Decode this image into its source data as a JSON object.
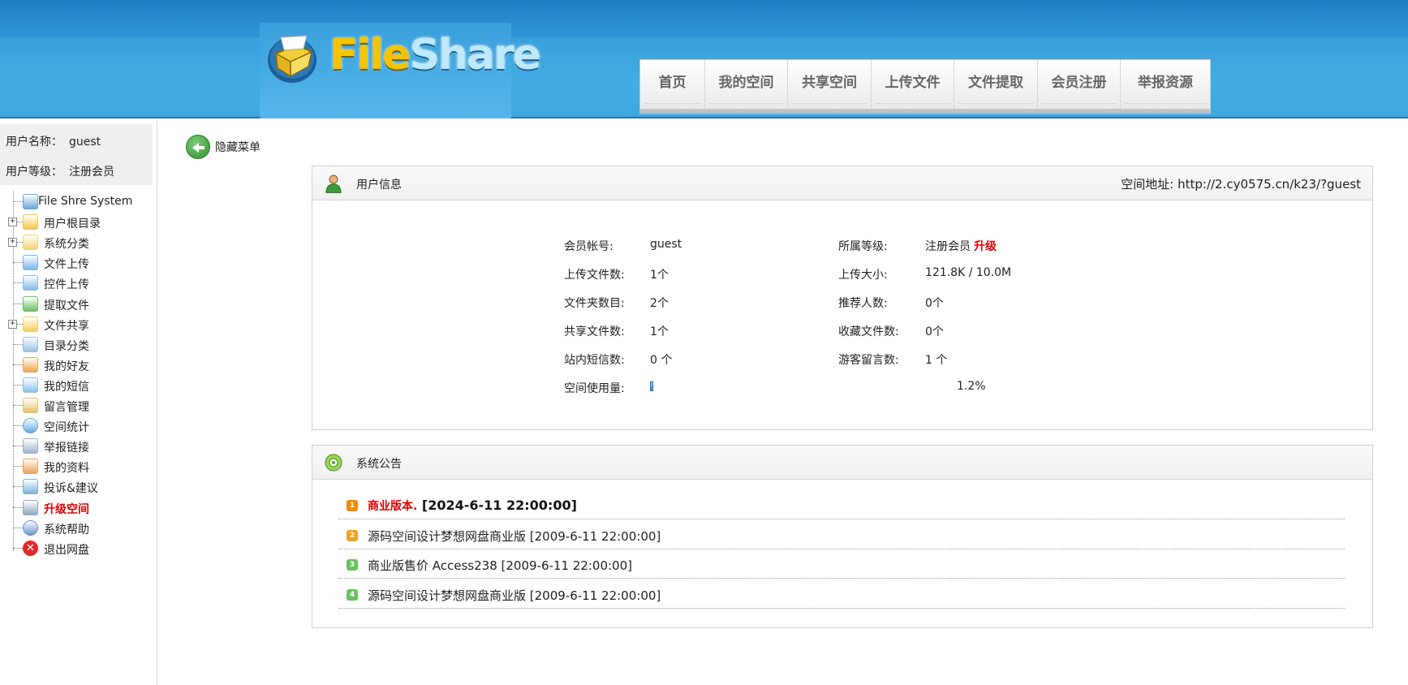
{
  "header": {
    "logo_part1": "File",
    "logo_part2": "Share",
    "nav": [
      "首页",
      "我的空间",
      "共享空间",
      "上传文件",
      "文件提取",
      "会员注册",
      "举报资源"
    ]
  },
  "sidebar": {
    "username_label": "用户名称：",
    "username_value": "guest",
    "level_label": "用户等级：",
    "level_value": "注册会员",
    "items": [
      {
        "label": "File Shre System",
        "icon": "system-icon",
        "expandable": false,
        "highlight": false
      },
      {
        "label": "用户根目录",
        "icon": "folder-icon",
        "expandable": true,
        "highlight": false
      },
      {
        "label": "系统分类",
        "icon": "folders-icon",
        "expandable": true,
        "highlight": false
      },
      {
        "label": "文件上传",
        "icon": "file-upload-icon",
        "expandable": false,
        "highlight": false
      },
      {
        "label": "控件上传",
        "icon": "control-upload-icon",
        "expandable": false,
        "highlight": false
      },
      {
        "label": "提取文件",
        "icon": "extract-icon",
        "expandable": false,
        "highlight": false
      },
      {
        "label": "文件共享",
        "icon": "shared-folder-icon",
        "expandable": true,
        "highlight": false
      },
      {
        "label": "目录分类",
        "icon": "catalog-icon",
        "expandable": false,
        "highlight": false
      },
      {
        "label": "我的好友",
        "icon": "friends-icon",
        "expandable": false,
        "highlight": false
      },
      {
        "label": "我的短信",
        "icon": "message-icon",
        "expandable": false,
        "highlight": false
      },
      {
        "label": "留言管理",
        "icon": "guestbook-icon",
        "expandable": false,
        "highlight": false
      },
      {
        "label": "空间统计",
        "icon": "pie-chart-icon",
        "expandable": false,
        "highlight": false
      },
      {
        "label": "举报链接",
        "icon": "report-icon",
        "expandable": false,
        "highlight": false
      },
      {
        "label": "我的资料",
        "icon": "profile-icon",
        "expandable": false,
        "highlight": false
      },
      {
        "label": "投诉&建议",
        "icon": "feedback-icon",
        "expandable": false,
        "highlight": false
      },
      {
        "label": "升级空间",
        "icon": "cart-icon",
        "expandable": false,
        "highlight": true
      },
      {
        "label": "系统帮助",
        "icon": "help-icon",
        "expandable": false,
        "highlight": false
      },
      {
        "label": "退出网盘",
        "icon": "exit-icon",
        "expandable": false,
        "highlight": false
      }
    ]
  },
  "hide_menu": "隐藏菜单",
  "user_panel": {
    "title": "用户信息",
    "space_address_label": "空间地址:",
    "space_address": "http://2.cy0575.cn/k23/?guest",
    "fields_left": [
      {
        "label": "会员帐号:",
        "value": "guest"
      },
      {
        "label": "上传文件数:",
        "value": "1个"
      },
      {
        "label": "文件夹数目:",
        "value": "2个"
      },
      {
        "label": "共享文件数:",
        "value": "1个"
      },
      {
        "label": "站内短信数:",
        "value": "0 个"
      },
      {
        "label": "空间使用量:",
        "value": ""
      }
    ],
    "fields_right": [
      {
        "label": "所属等级:",
        "value": "注册会员"
      },
      {
        "label": "上传大小:",
        "value": "121.8K / 10.0M"
      },
      {
        "label": "推荐人数:",
        "value": "0个"
      },
      {
        "label": "收藏文件数:",
        "value": "0个"
      },
      {
        "label": "游客留言数:",
        "value": "1 个"
      }
    ],
    "upgrade_link": "升级",
    "usage_fraction": 0.012,
    "usage_text": "1.2%"
  },
  "notice_panel": {
    "title": "系统公告",
    "items": [
      {
        "num": "1",
        "text": "商业版本.",
        "date": "[2024-6-11 22:00:00]",
        "num_color": "#f08a00"
      },
      {
        "num": "2",
        "text": "源码空间设计梦想网盘商业版",
        "date": "[2009-6-11 22:00:00]",
        "num_color": "#f0a020"
      },
      {
        "num": "3",
        "text": "商业版售价 Access238",
        "date": "[2009-6-11 22:00:00]",
        "num_color": "#6cc060"
      },
      {
        "num": "4",
        "text": "源码空间设计梦想网盘商业版",
        "date": "[2009-6-11 22:00:00]",
        "num_color": "#6cc060"
      }
    ]
  },
  "colors": {
    "header_blue": "#39a2dd",
    "accent_red": "#e00000",
    "panel_border": "#cfcfcf"
  }
}
